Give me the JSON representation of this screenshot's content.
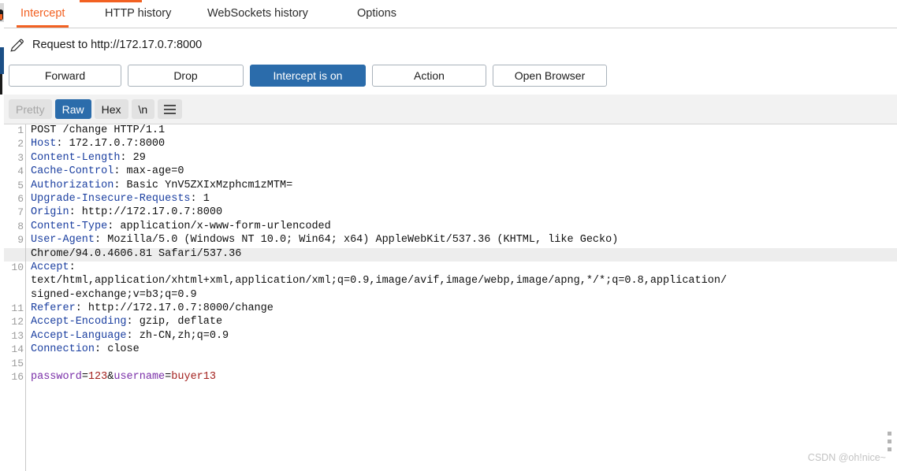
{
  "tabs": [
    {
      "label": "Intercept",
      "active": true
    },
    {
      "label": "HTTP history",
      "active": false
    },
    {
      "label": "WebSockets history",
      "active": false
    },
    {
      "label": "Options",
      "active": false
    }
  ],
  "request_header": {
    "icon": "pencil-icon",
    "title": "Request to http://172.17.0.7:8000"
  },
  "buttons": [
    {
      "label": "Forward",
      "primary": false
    },
    {
      "label": "Drop",
      "primary": false
    },
    {
      "label": "Intercept is on",
      "primary": true
    },
    {
      "label": "Action",
      "primary": false
    },
    {
      "label": "Open Browser",
      "primary": false
    }
  ],
  "view_modes": [
    {
      "label": "Pretty",
      "state": "disabled"
    },
    {
      "label": "Raw",
      "state": "selected"
    },
    {
      "label": "Hex",
      "state": "normal"
    },
    {
      "label": "\\n",
      "state": "normal"
    }
  ],
  "menu_icon": "hamburger-menu-icon",
  "colors": {
    "accent_orange": "#f26122",
    "primary_blue": "#2b6cab",
    "header_name_blue": "#1b3fa0",
    "param_name_purple": "#7a2fa8",
    "param_value_red": "#a3211e",
    "highlight_row": "#ededed"
  },
  "request": {
    "lines": [
      {
        "num": "1",
        "segments": [
          {
            "t": "POST /change HTTP/1.1",
            "c": "plain"
          }
        ]
      },
      {
        "num": "2",
        "segments": [
          {
            "t": "Host",
            "c": "hname"
          },
          {
            "t": ": 172.17.0.7:8000",
            "c": "plain"
          }
        ]
      },
      {
        "num": "3",
        "segments": [
          {
            "t": "Content-Length",
            "c": "hname"
          },
          {
            "t": ": 29",
            "c": "plain"
          }
        ]
      },
      {
        "num": "4",
        "segments": [
          {
            "t": "Cache-Control",
            "c": "hname"
          },
          {
            "t": ": max-age=0",
            "c": "plain"
          }
        ]
      },
      {
        "num": "5",
        "segments": [
          {
            "t": "Authorization",
            "c": "hname"
          },
          {
            "t": ": Basic YnV5ZXIxMzphcm1zMTM=",
            "c": "plain"
          }
        ]
      },
      {
        "num": "6",
        "segments": [
          {
            "t": "Upgrade-Insecure-Requests",
            "c": "hname"
          },
          {
            "t": ": 1",
            "c": "plain"
          }
        ]
      },
      {
        "num": "7",
        "segments": [
          {
            "t": "Origin",
            "c": "hname"
          },
          {
            "t": ": http://172.17.0.7:8000",
            "c": "plain"
          }
        ]
      },
      {
        "num": "8",
        "segments": [
          {
            "t": "Content-Type",
            "c": "hname"
          },
          {
            "t": ": application/x-www-form-urlencoded",
            "c": "plain"
          }
        ]
      },
      {
        "num": "9",
        "segments": [
          {
            "t": "User-Agent",
            "c": "hname"
          },
          {
            "t": ": Mozilla/5.0 (Windows NT 10.0; Win64; x64) AppleWebKit/537.36 (KHTML, like Gecko)",
            "c": "plain"
          }
        ]
      },
      {
        "num": "",
        "highlight": true,
        "segments": [
          {
            "t": "Chrome/94.0.4606.81 Safari/537.36",
            "c": "plain"
          }
        ]
      },
      {
        "num": "10",
        "segments": [
          {
            "t": "Accept",
            "c": "hname"
          },
          {
            "t": ":",
            "c": "plain"
          }
        ]
      },
      {
        "num": "",
        "segments": [
          {
            "t": "text/html,application/xhtml+xml,application/xml;q=0.9,image/avif,image/webp,image/apng,*/*;q=0.8,application/",
            "c": "plain"
          }
        ]
      },
      {
        "num": "",
        "segments": [
          {
            "t": "signed-exchange;v=b3;q=0.9",
            "c": "plain"
          }
        ]
      },
      {
        "num": "11",
        "segments": [
          {
            "t": "Referer",
            "c": "hname"
          },
          {
            "t": ": http://172.17.0.7:8000/change",
            "c": "plain"
          }
        ]
      },
      {
        "num": "12",
        "segments": [
          {
            "t": "Accept-Encoding",
            "c": "hname"
          },
          {
            "t": ": gzip, deflate",
            "c": "plain"
          }
        ]
      },
      {
        "num": "13",
        "segments": [
          {
            "t": "Accept-Language",
            "c": "hname"
          },
          {
            "t": ": zh-CN,zh;q=0.9",
            "c": "plain"
          }
        ]
      },
      {
        "num": "14",
        "segments": [
          {
            "t": "Connection",
            "c": "hname"
          },
          {
            "t": ": close",
            "c": "plain"
          }
        ]
      },
      {
        "num": "15",
        "segments": [
          {
            "t": "",
            "c": "plain"
          }
        ]
      },
      {
        "num": "16",
        "segments": [
          {
            "t": "password",
            "c": "pname"
          },
          {
            "t": "=",
            "c": "plain"
          },
          {
            "t": "123",
            "c": "pval"
          },
          {
            "t": "&",
            "c": "plain"
          },
          {
            "t": "username",
            "c": "pname"
          },
          {
            "t": "=",
            "c": "plain"
          },
          {
            "t": "buyer13",
            "c": "pval"
          }
        ]
      }
    ]
  },
  "watermark": "CSDN @oh!nice~"
}
